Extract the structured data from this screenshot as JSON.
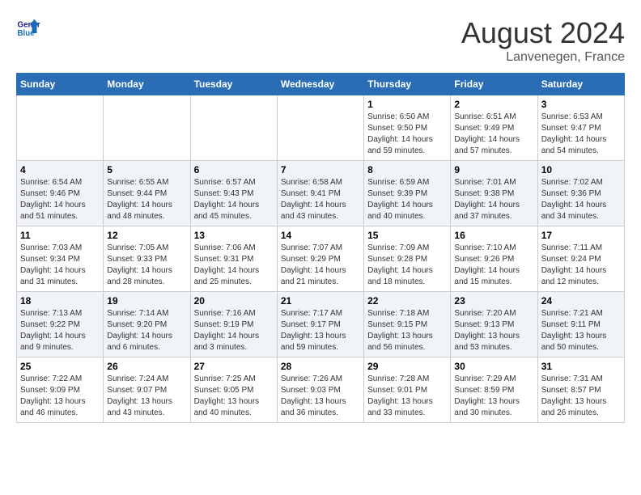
{
  "header": {
    "logo_line1": "General",
    "logo_line2": "Blue",
    "month_title": "August 2024",
    "location": "Lanvenegen, France"
  },
  "days_of_week": [
    "Sunday",
    "Monday",
    "Tuesday",
    "Wednesday",
    "Thursday",
    "Friday",
    "Saturday"
  ],
  "weeks": [
    [
      {
        "day": "",
        "info": ""
      },
      {
        "day": "",
        "info": ""
      },
      {
        "day": "",
        "info": ""
      },
      {
        "day": "",
        "info": ""
      },
      {
        "day": "1",
        "info": "Sunrise: 6:50 AM\nSunset: 9:50 PM\nDaylight: 14 hours\nand 59 minutes."
      },
      {
        "day": "2",
        "info": "Sunrise: 6:51 AM\nSunset: 9:49 PM\nDaylight: 14 hours\nand 57 minutes."
      },
      {
        "day": "3",
        "info": "Sunrise: 6:53 AM\nSunset: 9:47 PM\nDaylight: 14 hours\nand 54 minutes."
      }
    ],
    [
      {
        "day": "4",
        "info": "Sunrise: 6:54 AM\nSunset: 9:46 PM\nDaylight: 14 hours\nand 51 minutes."
      },
      {
        "day": "5",
        "info": "Sunrise: 6:55 AM\nSunset: 9:44 PM\nDaylight: 14 hours\nand 48 minutes."
      },
      {
        "day": "6",
        "info": "Sunrise: 6:57 AM\nSunset: 9:43 PM\nDaylight: 14 hours\nand 45 minutes."
      },
      {
        "day": "7",
        "info": "Sunrise: 6:58 AM\nSunset: 9:41 PM\nDaylight: 14 hours\nand 43 minutes."
      },
      {
        "day": "8",
        "info": "Sunrise: 6:59 AM\nSunset: 9:39 PM\nDaylight: 14 hours\nand 40 minutes."
      },
      {
        "day": "9",
        "info": "Sunrise: 7:01 AM\nSunset: 9:38 PM\nDaylight: 14 hours\nand 37 minutes."
      },
      {
        "day": "10",
        "info": "Sunrise: 7:02 AM\nSunset: 9:36 PM\nDaylight: 14 hours\nand 34 minutes."
      }
    ],
    [
      {
        "day": "11",
        "info": "Sunrise: 7:03 AM\nSunset: 9:34 PM\nDaylight: 14 hours\nand 31 minutes."
      },
      {
        "day": "12",
        "info": "Sunrise: 7:05 AM\nSunset: 9:33 PM\nDaylight: 14 hours\nand 28 minutes."
      },
      {
        "day": "13",
        "info": "Sunrise: 7:06 AM\nSunset: 9:31 PM\nDaylight: 14 hours\nand 25 minutes."
      },
      {
        "day": "14",
        "info": "Sunrise: 7:07 AM\nSunset: 9:29 PM\nDaylight: 14 hours\nand 21 minutes."
      },
      {
        "day": "15",
        "info": "Sunrise: 7:09 AM\nSunset: 9:28 PM\nDaylight: 14 hours\nand 18 minutes."
      },
      {
        "day": "16",
        "info": "Sunrise: 7:10 AM\nSunset: 9:26 PM\nDaylight: 14 hours\nand 15 minutes."
      },
      {
        "day": "17",
        "info": "Sunrise: 7:11 AM\nSunset: 9:24 PM\nDaylight: 14 hours\nand 12 minutes."
      }
    ],
    [
      {
        "day": "18",
        "info": "Sunrise: 7:13 AM\nSunset: 9:22 PM\nDaylight: 14 hours\nand 9 minutes."
      },
      {
        "day": "19",
        "info": "Sunrise: 7:14 AM\nSunset: 9:20 PM\nDaylight: 14 hours\nand 6 minutes."
      },
      {
        "day": "20",
        "info": "Sunrise: 7:16 AM\nSunset: 9:19 PM\nDaylight: 14 hours\nand 3 minutes."
      },
      {
        "day": "21",
        "info": "Sunrise: 7:17 AM\nSunset: 9:17 PM\nDaylight: 13 hours\nand 59 minutes."
      },
      {
        "day": "22",
        "info": "Sunrise: 7:18 AM\nSunset: 9:15 PM\nDaylight: 13 hours\nand 56 minutes."
      },
      {
        "day": "23",
        "info": "Sunrise: 7:20 AM\nSunset: 9:13 PM\nDaylight: 13 hours\nand 53 minutes."
      },
      {
        "day": "24",
        "info": "Sunrise: 7:21 AM\nSunset: 9:11 PM\nDaylight: 13 hours\nand 50 minutes."
      }
    ],
    [
      {
        "day": "25",
        "info": "Sunrise: 7:22 AM\nSunset: 9:09 PM\nDaylight: 13 hours\nand 46 minutes."
      },
      {
        "day": "26",
        "info": "Sunrise: 7:24 AM\nSunset: 9:07 PM\nDaylight: 13 hours\nand 43 minutes."
      },
      {
        "day": "27",
        "info": "Sunrise: 7:25 AM\nSunset: 9:05 PM\nDaylight: 13 hours\nand 40 minutes."
      },
      {
        "day": "28",
        "info": "Sunrise: 7:26 AM\nSunset: 9:03 PM\nDaylight: 13 hours\nand 36 minutes."
      },
      {
        "day": "29",
        "info": "Sunrise: 7:28 AM\nSunset: 9:01 PM\nDaylight: 13 hours\nand 33 minutes."
      },
      {
        "day": "30",
        "info": "Sunrise: 7:29 AM\nSunset: 8:59 PM\nDaylight: 13 hours\nand 30 minutes."
      },
      {
        "day": "31",
        "info": "Sunrise: 7:31 AM\nSunset: 8:57 PM\nDaylight: 13 hours\nand 26 minutes."
      }
    ]
  ]
}
